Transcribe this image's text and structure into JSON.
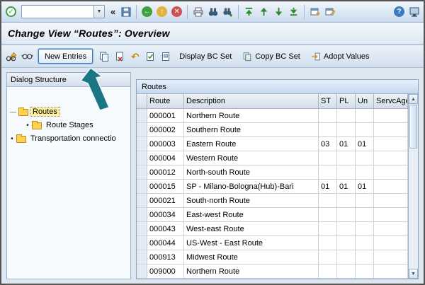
{
  "title": "Change View “Routes”: Overview",
  "top_toolbar": {
    "command_value": "",
    "collapse_glyph": "«"
  },
  "icons": {
    "enter_check": "✓",
    "dropdown_arrow": "▼",
    "back_arrow": "←",
    "exit_arrow": "↑",
    "cancel_x": "✕",
    "undo": "↶",
    "help": "?",
    "scroll_up": "▲",
    "scroll_down": "▼",
    "tree_dash": "—",
    "tree_bullet": "•"
  },
  "app_toolbar": {
    "new_entries": "New Entries",
    "display_bc_set": "Display BC Set",
    "copy_bc_set": "Copy BC Set",
    "adopt_values": "Adopt Values"
  },
  "sidebar": {
    "header": "Dialog Structure",
    "items": [
      {
        "label": "Routes",
        "selected": true
      },
      {
        "label": "Route Stages",
        "selected": false
      },
      {
        "label": "Transportation connectio",
        "selected": false
      }
    ]
  },
  "routes_table": {
    "title": "Routes",
    "columns": [
      "Route",
      "Description",
      "ST",
      "PL",
      "Un",
      "ServcAgent"
    ],
    "rows": [
      [
        "000001",
        "Northern Route",
        "",
        "",
        "",
        ""
      ],
      [
        "000002",
        "Southern Route",
        "",
        "",
        "",
        ""
      ],
      [
        "000003",
        "Eastern Route",
        "03",
        "01",
        "01",
        ""
      ],
      [
        "000004",
        "Western Route",
        "",
        "",
        "",
        ""
      ],
      [
        "000012",
        "North-south Route",
        "",
        "",
        "",
        ""
      ],
      [
        "000015",
        "SP - Milano-Bologna(Hub)-Bari",
        "01",
        "01",
        "01",
        ""
      ],
      [
        "000021",
        "South-north Route",
        "",
        "",
        "",
        ""
      ],
      [
        "000034",
        "East-west Route",
        "",
        "",
        "",
        ""
      ],
      [
        "000043",
        "West-east Route",
        "",
        "",
        "",
        ""
      ],
      [
        "000044",
        "US-West - East Route",
        "",
        "",
        "",
        ""
      ],
      [
        "000913",
        "Midwest Route",
        "",
        "",
        "",
        ""
      ],
      [
        "009000",
        "Northern Route",
        "",
        "",
        "",
        ""
      ]
    ]
  },
  "colors": {
    "highlight_border_blue": "#3c7cc4",
    "annotation_teal": "#1a7685",
    "selected_tree_yellow": "#ffefa0",
    "folder_yellow": "#ffd24d"
  }
}
